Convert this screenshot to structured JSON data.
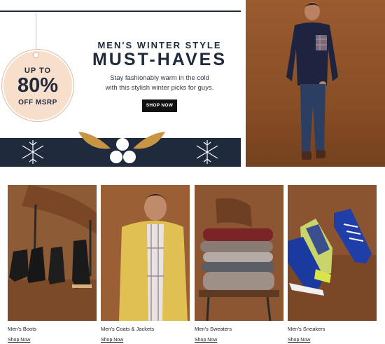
{
  "hero": {
    "tag": {
      "line1": "UP TO",
      "percent": "80%",
      "line3": "OFF MSRP"
    },
    "eyebrow": "MEN'S WINTER STYLE",
    "title": "MUST-HAVES",
    "subtitle_line1": "Stay fashionably warm in the cold",
    "subtitle_line2": "with this stylish winter picks for guys.",
    "cta_label": "SHOP NOW"
  },
  "categories": [
    {
      "label": "Men's Boots",
      "link": "Shop Now"
    },
    {
      "label": "Men's Coats & Jackets",
      "link": "Shop Now"
    },
    {
      "label": "Men's Sweaters",
      "link": "Shop Now"
    },
    {
      "label": "Men's Sneakers",
      "link": "Shop Now"
    }
  ],
  "colors": {
    "navy": "#1f2a3c",
    "peach": "#f8dfcc",
    "gold": "#c89545",
    "brown": "#8b5b37"
  }
}
